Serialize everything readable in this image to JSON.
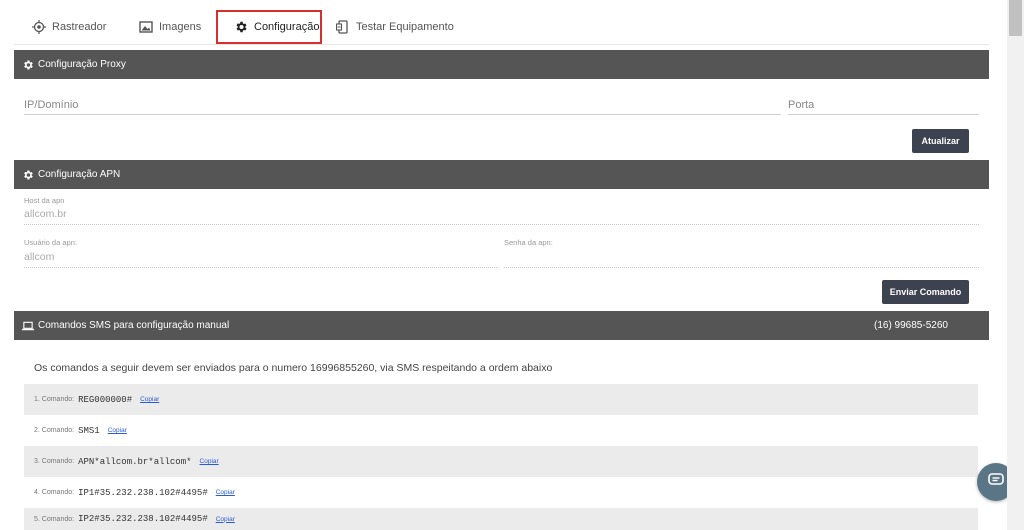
{
  "tabs": [
    {
      "label": "Rastreador",
      "icon": "target-icon"
    },
    {
      "label": "Imagens",
      "icon": "image-icon"
    },
    {
      "label": "Configuração",
      "icon": "gear-icon",
      "active": true
    },
    {
      "label": "Testar Equipamento",
      "icon": "device-test-icon"
    }
  ],
  "proxy": {
    "title": "Configuração Proxy",
    "ip_placeholder": "IP/Domínio",
    "port_placeholder": "Porta",
    "update_label": "Atualizar"
  },
  "apn": {
    "title": "Configuração APN",
    "host_label": "Host da apn",
    "host_value": "allcom.br",
    "user_label": "Usuário da apn:",
    "user_value": "allcom",
    "pass_label": "Senha da apn:",
    "pass_value": "",
    "send_label": "Enviar Comando"
  },
  "sms": {
    "title": "Comandos SMS para configuração manual",
    "phone": "(16) 99685-5260",
    "intro": "Os comandos a seguir devem ser enviados para o numero 16996855260, via SMS respeitando a ordem abaixo",
    "copy_label": "Copiar",
    "commands": [
      {
        "label": "1. Comando:",
        "code": "REG000000#"
      },
      {
        "label": "2. Comando:",
        "code": "SMS1"
      },
      {
        "label": "3. Comando:",
        "code": "APN*allcom.br*allcom*"
      },
      {
        "label": "4. Comando:",
        "code": "IP1#35.232.238.102#4495#"
      },
      {
        "label": "5. Comando:",
        "code": "IP2#35.232.238.102#4495#"
      }
    ]
  },
  "colors": {
    "header_bg": "#555555",
    "button_bg": "#3d4250",
    "active_tab_border": "#d43030",
    "link": "#2a5ad7"
  }
}
